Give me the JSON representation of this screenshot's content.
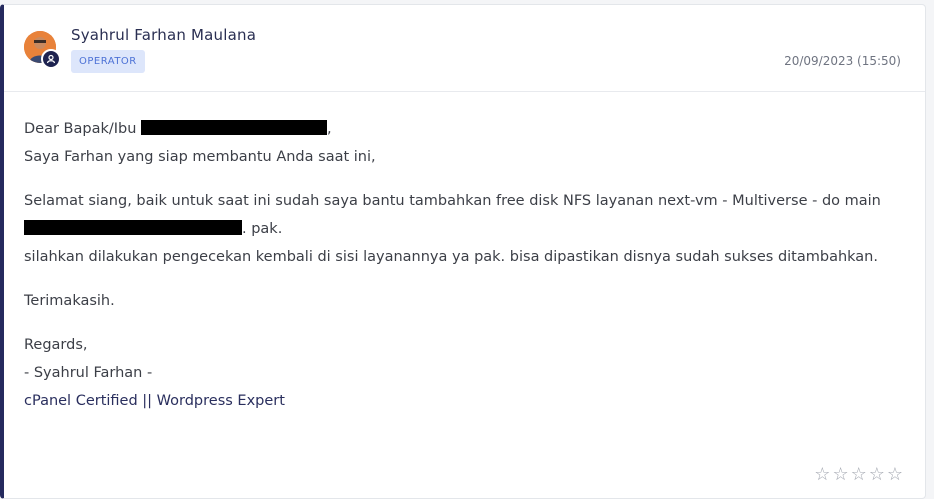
{
  "ticket_reply": {
    "author": {
      "name": "Syahrul Farhan Maulana",
      "role": "OPERATOR"
    },
    "timestamp": "20/09/2023 (15:50)",
    "message": {
      "greeting": "Dear Bapak/Ibu ",
      "greeting_end": ",",
      "intro": "Saya Farhan yang siap membantu Anda saat ini,",
      "para1_text": "Selamat siang, baik untuk saat ini sudah saya bantu tambahkan free disk NFS layanan next-vm - Multiverse - do main ",
      "para1_end": ". pak.",
      "para2": "silahkan dilakukan pengecekan kembali di sisi layanannya ya pak. bisa dipastikan disnya sudah sukses ditambahkan.",
      "thanks": "Terimakasih.",
      "regards": "Regards,",
      "signature_name": "- Syahrul Farhan -",
      "signature_title": "cPanel Certified || Wordpress Expert"
    },
    "rating": {
      "max": 5,
      "value": 0,
      "star_glyph": "☆"
    }
  },
  "colors": {
    "accent_border": "#252a5e",
    "badge_bg": "#dde6fb",
    "badge_text": "#4d72d6",
    "avatar_bg": "#e57a2c"
  }
}
